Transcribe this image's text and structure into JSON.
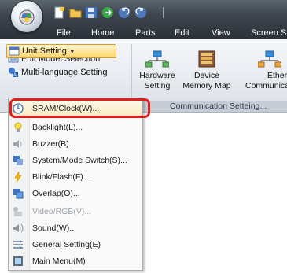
{
  "tabs": [
    "File",
    "Home",
    "Parts",
    "Edit",
    "View",
    "Screen S"
  ],
  "ribbon": {
    "edit_model": "Edit Model Selection",
    "multi_language": "Multi-language Setting",
    "unit_setting": "Unit Setting",
    "hardware_line1": "Hardware",
    "hardware_line2": "Setting",
    "device_line1": "Device",
    "device_line2": "Memory Map",
    "ethernet_line1": "Etherne",
    "ethernet_line2": "Communicat",
    "group_label": "Communication Setteing..."
  },
  "menu": {
    "items": [
      {
        "label": "SRAM/Clock(W)...",
        "icon": "clock-icon",
        "enabled": true
      },
      {
        "label": "Backlight(L)...",
        "icon": "bulb-icon",
        "enabled": true
      },
      {
        "label": "Buzzer(B)...",
        "icon": "speaker-icon",
        "enabled": true
      },
      {
        "label": "System/Mode Switch(S)...",
        "icon": "system-switch-icon",
        "enabled": true
      },
      {
        "label": "Blink/Flash(F)...",
        "icon": "lightning-icon",
        "enabled": true
      },
      {
        "label": "Overlap(O)...",
        "icon": "overlap-icon",
        "enabled": true
      },
      {
        "label": "Video/RGB(V)...",
        "icon": "video-icon",
        "enabled": false
      },
      {
        "label": "Sound(W)...",
        "icon": "sound-icon",
        "enabled": true
      },
      {
        "label": "General Setting(E)",
        "icon": "general-setting-icon",
        "enabled": true
      },
      {
        "label": "Main Menu(M)",
        "icon": "main-menu-icon",
        "enabled": true
      }
    ]
  },
  "colors": {
    "highlight_border": "#e11e1e",
    "active_button": "#ffd36b"
  }
}
